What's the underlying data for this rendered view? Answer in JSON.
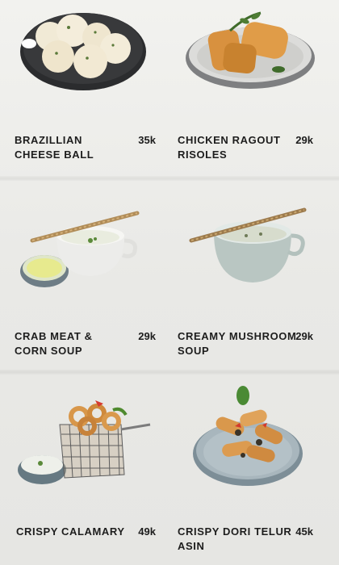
{
  "menu": {
    "items": [
      {
        "name": "BRAZILLIAN CHEESE BALL",
        "price": "35k"
      },
      {
        "name": "CHICKEN RAGOUT RISOLES",
        "price": "29k"
      },
      {
        "name": "CRAB MEAT & CORN SOUP",
        "price": "29k"
      },
      {
        "name": "CREAMY MUSHROOM SOUP",
        "price": "29k"
      },
      {
        "name": "CRISPY CALAMARY",
        "price": "49k"
      },
      {
        "name": "CRISPY DORI TELUR ASIN",
        "price": "45k"
      }
    ]
  },
  "colors": {
    "background": "#ecece9",
    "text": "#1d1d1d",
    "plate_dark": "#2e2f31",
    "plate_grey": "#8d9ba3",
    "fried": "#d99a46"
  },
  "icons": [
    "cheese-ball-photo",
    "risoles-photo",
    "crab-soup-photo",
    "mushroom-soup-photo",
    "calamary-photo",
    "dori-photo"
  ]
}
